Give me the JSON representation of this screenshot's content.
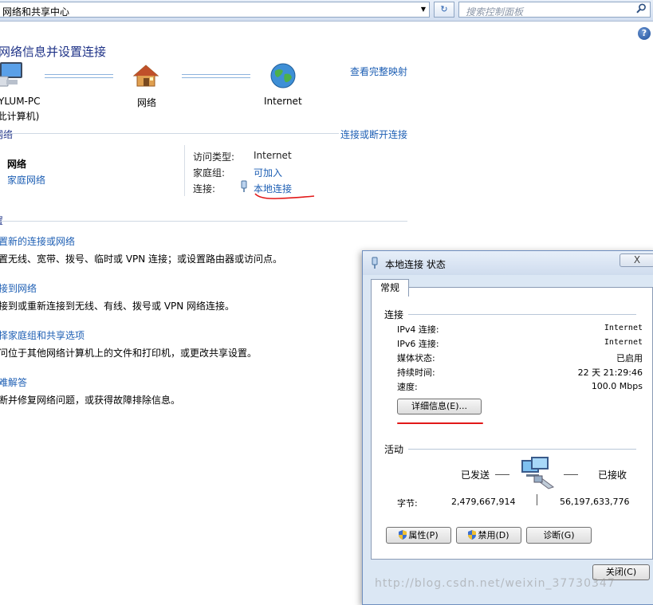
{
  "address_bar": {
    "path": "网络和共享中心",
    "search_placeholder": "搜索控制面板"
  },
  "page_title": "网络信息并设置连接",
  "network_map": {
    "computer_label_1": "YLUM-PC",
    "computer_label_2": "(此计算机)",
    "network_label": "网络",
    "internet_label": "Internet",
    "view_full_map": "查看完整映射"
  },
  "active_networks": {
    "heading": "网络",
    "connect_disconnect": "连接或断开连接",
    "network_name": "网络",
    "network_type": "家庭网络",
    "access_type_label": "访问类型:",
    "access_type_value": "Internet",
    "homegroup_label": "家庭组:",
    "homegroup_value": "可加入",
    "connections_label": "连接:",
    "connections_value": "本地连接"
  },
  "change_settings": {
    "heading": "置",
    "tasks": [
      {
        "link": "置新的连接或网络",
        "desc": "置无线、宽带、拨号、临时或 VPN 连接；或设置路由器或访问点。"
      },
      {
        "link": "接到网络",
        "desc": "接到或重新连接到无线、有线、拨号或 VPN 网络连接。"
      },
      {
        "link": "择家庭组和共享选项",
        "desc": "问位于其他网络计算机上的文件和打印机，或更改共享设置。"
      },
      {
        "link": "难解答",
        "desc": "断并修复网络问题，或获得故障排除信息。"
      }
    ]
  },
  "dialog": {
    "title": "本地连接 状态",
    "close_symbol": "X",
    "tab": "常规",
    "connection_group": "连接",
    "rows": [
      {
        "label": "IPv4 连接:",
        "value": "Internet"
      },
      {
        "label": "IPv6 连接:",
        "value": "Internet"
      },
      {
        "label": "媒体状态:",
        "value": "已启用"
      },
      {
        "label": "持续时间:",
        "value": "22 天 21:29:46"
      },
      {
        "label": "速度:",
        "value": "100.0 Mbps"
      }
    ],
    "details_button": "详细信息(E)...",
    "activity_group": "活动",
    "sent_label": "已发送",
    "received_label": "已接收",
    "bytes_label": "字节:",
    "bytes_sent": "2,479,667,914",
    "bytes_received": "56,197,633,776",
    "properties_button": "属性(P)",
    "disable_button": "禁用(D)",
    "diagnose_button": "诊断(G)",
    "close_button": "关闭(C)"
  },
  "watermark": "http://blog.csdn.net/weixin_37730347",
  "colors": {
    "link": "#1e5fb4",
    "title": "#1e3287",
    "annotation": "#e21818"
  }
}
